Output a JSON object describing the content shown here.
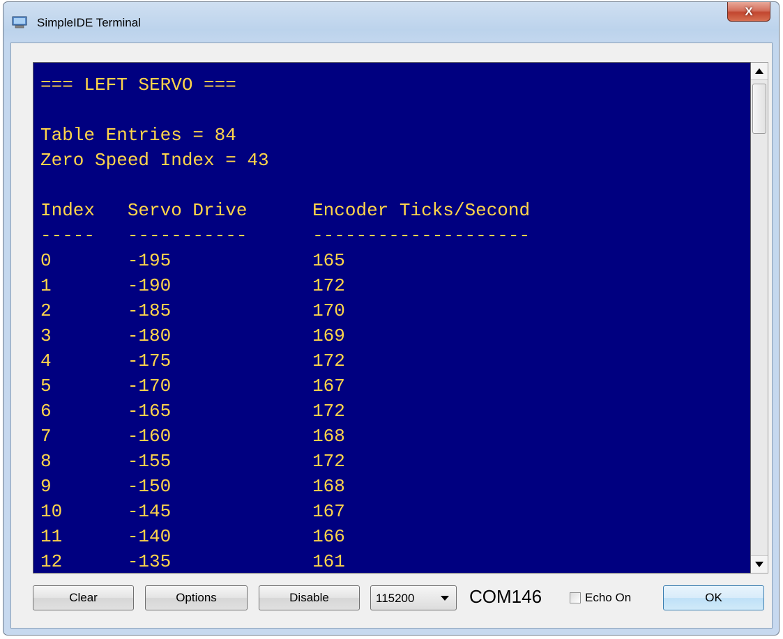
{
  "window": {
    "title": "SimpleIDE Terminal",
    "close_label": "X"
  },
  "terminal": {
    "lines": [
      "=== LEFT SERVO ===",
      "",
      "Table Entries = 84",
      "Zero Speed Index = 43",
      "",
      "Index   Servo Drive      Encoder Ticks/Second",
      "-----   -----------      --------------------",
      "0       -195             165",
      "1       -190             172",
      "2       -185             170",
      "3       -180             169",
      "4       -175             172",
      "5       -170             167",
      "6       -165             172",
      "7       -160             168",
      "8       -155             172",
      "9       -150             168",
      "10      -145             167",
      "11      -140             166",
      "12      -135             161"
    ],
    "background_color": "#000080",
    "text_color": "#ffd54a"
  },
  "toolbar": {
    "clear_label": "Clear",
    "options_label": "Options",
    "disable_label": "Disable",
    "baud_rate": "115200",
    "port": "COM146",
    "echo_label": "Echo On",
    "echo_checked": false,
    "ok_label": "OK"
  },
  "icons": {
    "app": "monitor-icon",
    "close": "close-icon",
    "scroll_up": "scroll-up-arrow-icon",
    "scroll_down": "scroll-down-arrow-icon",
    "dropdown": "chevron-down-icon"
  }
}
